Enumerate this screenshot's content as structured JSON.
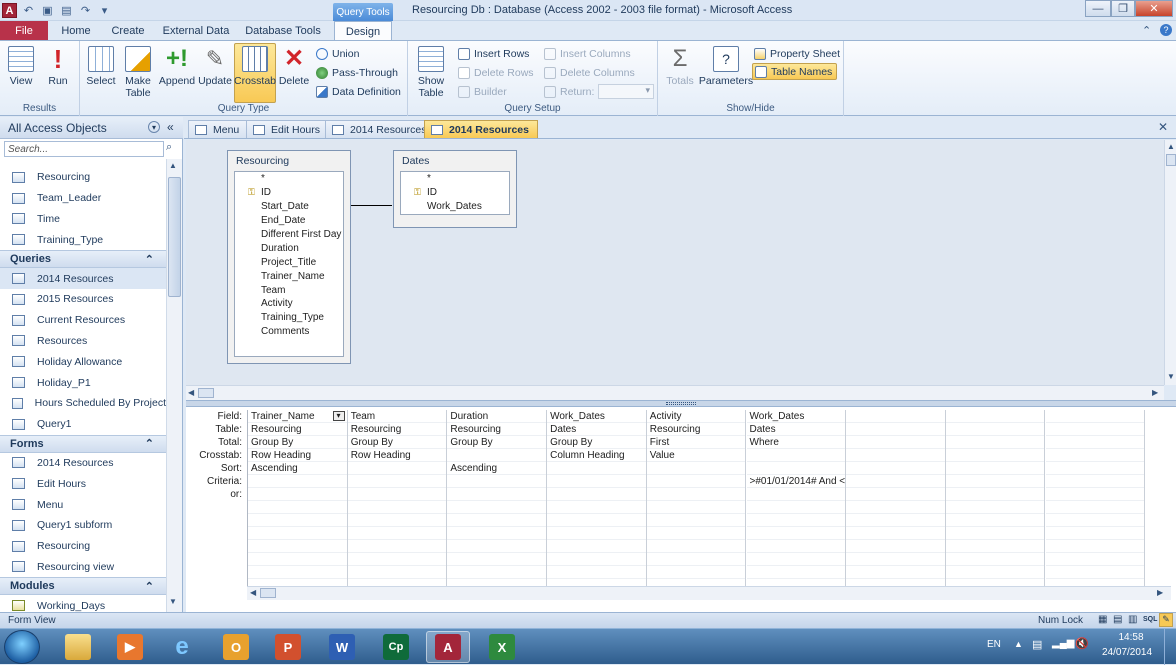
{
  "window": {
    "title": "Resourcing Db : Database (Access 2002 - 2003 file format)  -  Microsoft Access",
    "context_tab": "Query Tools"
  },
  "ribbon_tabs": [
    "File",
    "Home",
    "Create",
    "External Data",
    "Database Tools",
    "Design"
  ],
  "ribbon": {
    "results": {
      "label": "Results",
      "view": "View",
      "run": "Run"
    },
    "query_type": {
      "label": "Query Type",
      "select": "Select",
      "make_table": "Make Table",
      "append": "Append",
      "update": "Update",
      "crosstab": "Crosstab",
      "delete": "Delete",
      "union": "Union",
      "pass_through": "Pass-Through",
      "data_definition": "Data Definition"
    },
    "query_setup": {
      "label": "Query Setup",
      "show_table": "Show Table",
      "insert_rows": "Insert Rows",
      "delete_rows": "Delete Rows",
      "builder": "Builder",
      "insert_columns": "Insert Columns",
      "delete_columns": "Delete Columns",
      "return": "Return:"
    },
    "show_hide": {
      "label": "Show/Hide",
      "totals": "Totals",
      "parameters": "Parameters",
      "property_sheet": "Property Sheet",
      "table_names": "Table Names"
    }
  },
  "nav": {
    "header": "All Access Objects",
    "search_placeholder": "Search...",
    "tables": [
      "Resourcing",
      "Team_Leader",
      "Time",
      "Training_Type"
    ],
    "queries_label": "Queries",
    "queries": [
      "2014 Resources",
      "2015 Resources",
      "Current Resources",
      "Resources",
      "Holiday Allowance",
      "Holiday_P1",
      "Hours Scheduled By Project",
      "Query1"
    ],
    "forms_label": "Forms",
    "forms": [
      "2014 Resources",
      "Edit Hours",
      "Menu",
      "Query1 subform",
      "Resourcing",
      "Resourcing view"
    ],
    "modules_label": "Modules",
    "modules": [
      "Working_Days"
    ]
  },
  "doc_tabs": [
    "Menu",
    "Edit Hours",
    "2014 Resources",
    "2014 Resources"
  ],
  "tables": {
    "resourcing": {
      "title": "Resourcing",
      "fields": [
        "*",
        "ID",
        "Start_Date",
        "End_Date",
        "Different First Day",
        "Duration",
        "Project_Title",
        "Trainer_Name",
        "Team",
        "Activity",
        "Training_Type",
        "Comments"
      ]
    },
    "dates": {
      "title": "Dates",
      "fields": [
        "*",
        "ID",
        "Work_Dates"
      ]
    }
  },
  "grid": {
    "row_labels": [
      "Field:",
      "Table:",
      "Total:",
      "Crosstab:",
      "Sort:",
      "Criteria:",
      "or:"
    ],
    "columns": [
      {
        "field": "Trainer_Name",
        "table": "Resourcing",
        "total": "Group By",
        "crosstab": "Row Heading",
        "sort": "Ascending",
        "criteria": ""
      },
      {
        "field": "Team",
        "table": "Resourcing",
        "total": "Group By",
        "crosstab": "Row Heading",
        "sort": "",
        "criteria": ""
      },
      {
        "field": "Duration",
        "table": "Resourcing",
        "total": "Group By",
        "crosstab": "",
        "sort": "Ascending",
        "criteria": ""
      },
      {
        "field": "Work_Dates",
        "table": "Dates",
        "total": "Group By",
        "crosstab": "Column Heading",
        "sort": "",
        "criteria": ""
      },
      {
        "field": "Activity",
        "table": "Resourcing",
        "total": "First",
        "crosstab": "Value",
        "sort": "",
        "criteria": ""
      },
      {
        "field": "Work_Dates",
        "table": "Dates",
        "total": "Where",
        "crosstab": "",
        "sort": "",
        "criteria": ">#01/01/2014# And <"
      }
    ]
  },
  "status": {
    "left": "Form View",
    "num_lock": "Num Lock"
  },
  "taskbar": {
    "lang": "EN",
    "time": "14:58",
    "date": "24/07/2014"
  }
}
